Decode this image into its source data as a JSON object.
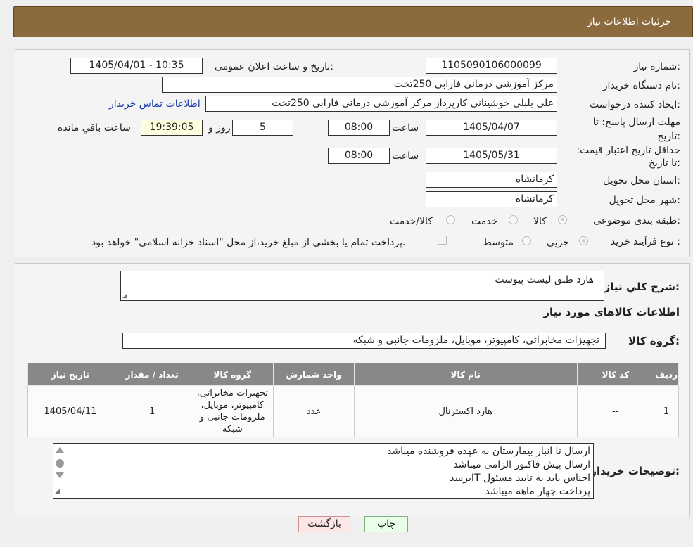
{
  "header": {
    "title": "جزئیات اطلاعات نیاز"
  },
  "form": {
    "need_number": {
      "label": "شماره نیاز:",
      "value": "1105090106000099"
    },
    "announce_datetime": {
      "label": "تاریخ و ساعت اعلان عمومی:",
      "value": "1405/04/01 - 10:35"
    },
    "buyer_org": {
      "label": "نام دستگاه خریدار:",
      "value": "مرکز آموزشی  درمانی فارابی 250تخت"
    },
    "requester": {
      "label": "ایجاد کننده درخواست:",
      "value": "علی بلبلی خوشینانی کارپرداز مرکز آموزشی  درمانی فارابی 250تخت"
    },
    "contact_link": "اطلاعات تماس خریدار",
    "reply_deadline": {
      "label": "مهلت ارسال پاسخ: تا تاریخ:",
      "date": "1405/04/07",
      "time_label": "ساعت",
      "time": "08:00",
      "days": "5",
      "days_label": "روز و",
      "remaining": "19:39:05",
      "remaining_label": "ساعت باقي مانده"
    },
    "price_validity": {
      "label": "حداقل تاریخ اعتبار قیمت: تا تاریخ:",
      "date": "1405/05/31",
      "time_label": "ساعت",
      "time": "08:00"
    },
    "province": {
      "label": "استان محل تحویل:",
      "value": "کرمانشاه"
    },
    "city": {
      "label": "شهر محل تحویل:",
      "value": "کرمانشاه"
    },
    "category": {
      "label": "طبقه بندی موضوعی:",
      "options": [
        "کالا",
        "خدمت",
        "کالا/خدمت"
      ],
      "selected": "کالا"
    },
    "purchase_type": {
      "label": "نوع فرآیند خرید :",
      "options": [
        "جزیی",
        "متوسط"
      ],
      "selected": "جزیی",
      "payment_note": "پرداخت تمام یا بخشی از مبلغ خرید،از محل \"اسناد خزانه اسلامی\" خواهد بود."
    }
  },
  "summary": {
    "label": "شرح کلي نياز:",
    "value": "هارد طبق لیست پیوست",
    "goods_title": "اطلاعات کالاهای مورد نیاز",
    "group_label": "گروه کالا:",
    "group_value": "تجهیزات مخابراتی، کامپیوتر، موبایل، ملزومات جانبی و شبکه"
  },
  "table": {
    "headers": [
      "ردیف",
      "کد کالا",
      "نام کالا",
      "واحد شمارش",
      "گروه کالا",
      "تعداد / مقدار",
      "تاریخ نیاز"
    ],
    "rows": [
      {
        "row": "1",
        "code": "--",
        "name": "هارد اکسترنال",
        "unit": "عدد",
        "group": "تجهیزات مخابراتی، کامپیوتر، موبایل، ملزومات جانبی و شبکه",
        "qty": "1",
        "date": "1405/04/11"
      }
    ]
  },
  "buyer_notes": {
    "label": "توضیحات خریدار:",
    "lines": [
      "ارسال تا انبار بیمارستان به عهده فروشنده میباشد",
      "ارسال پیش فاکتور الزامی میباشد",
      "اجناس باید به تایید مسئول ITبرسد",
      "پرداخت چهار ماهه میباشد"
    ]
  },
  "buttons": {
    "print": "چاپ",
    "back": "بازگشت"
  },
  "colors": {
    "header": "#8b6a3e",
    "link": "#1a3fb0",
    "print_btn": "#eaffea",
    "back_btn": "#ffe6e6",
    "table_header": "#888888"
  }
}
